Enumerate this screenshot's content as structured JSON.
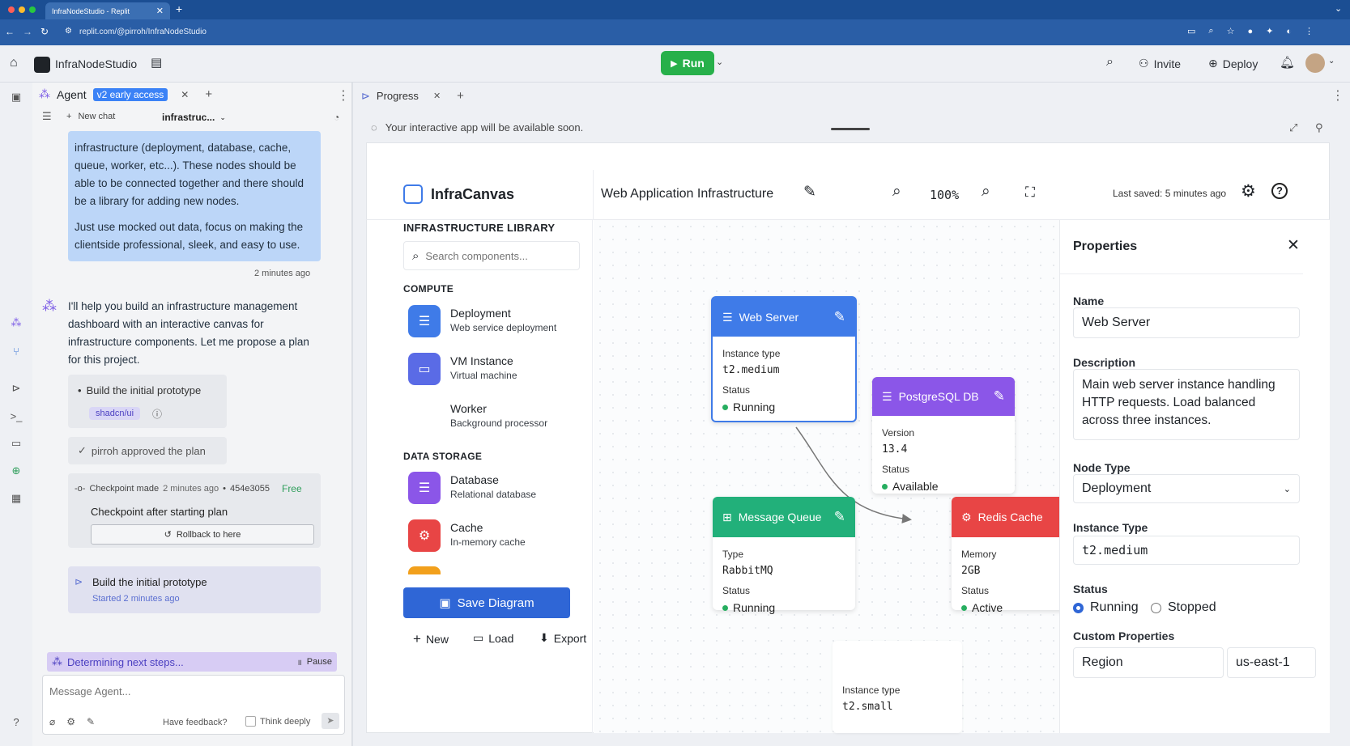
{
  "browser": {
    "tab_title": "InfraNodeStudio - Replit",
    "url": "replit.com/@pirroh/InfraNodeStudio"
  },
  "header": {
    "project_name": "InfraNodeStudio",
    "run_label": "Run",
    "invite_label": "Invite",
    "deploy_label": "Deploy"
  },
  "agent_panel": {
    "tab_label": "Agent",
    "badge": "v2 early access",
    "new_chat": "New chat",
    "chat_title": "infrastruc...",
    "user_message_p1": "infrastructure (deployment, database, cache, queue, worker, etc...). These nodes should be able to be connected together and there should be a library for adding new nodes.",
    "user_message_p2": "Just use mocked out data, focus on making the clientside professional, sleek, and easy to use.",
    "user_time": "2 minutes ago",
    "agent_message": "I'll help you build an infrastructure management dashboard with an interactive canvas for infrastructure components. Let me propose a plan for this project.",
    "plan_item": "Build the initial prototype",
    "plan_chip": "shadcn/ui",
    "approved": "pirroh approved the plan",
    "checkpoint_prefix": "Checkpoint made",
    "checkpoint_time": "2 minutes ago",
    "checkpoint_hash": "454e3055",
    "checkpoint_free": "Free",
    "checkpoint_title": "Checkpoint after starting plan",
    "rollback": "Rollback to here",
    "task_title": "Build the initial prototype",
    "task_started": "Started 2 minutes ago",
    "status_text": "Determining next steps...",
    "pause": "Pause",
    "input_placeholder": "Message Agent...",
    "feedback": "Have feedback?",
    "think_deeply": "Think deeply"
  },
  "progress_panel": {
    "tab_label": "Progress",
    "notice": "Your interactive app will be available soon."
  },
  "app": {
    "logo_text": "InfraCanvas",
    "diagram_title": "Web Application Infrastructure",
    "zoom": "100%",
    "last_saved": "Last saved: 5 minutes ago",
    "library_title": "INFRASTRUCTURE LIBRARY",
    "search_placeholder": "Search components...",
    "compute_label": "COMPUTE",
    "data_storage_label": "DATA STORAGE",
    "compute_items": [
      {
        "name": "Deployment",
        "sub": "Web service deployment",
        "color": "#3f7be8"
      },
      {
        "name": "VM Instance",
        "sub": "Virtual machine",
        "color": "#5a6be6"
      },
      {
        "name": "Worker",
        "sub": "Background processor",
        "color": ""
      }
    ],
    "storage_items": [
      {
        "name": "Database",
        "sub": "Relational database",
        "color": "#8b56e8"
      },
      {
        "name": "Cache",
        "sub": "In-memory cache",
        "color": "#e84545"
      }
    ],
    "save_button": "Save Diagram",
    "new_label": "New",
    "load_label": "Load",
    "export_label": "Export"
  },
  "nodes": {
    "web_server": {
      "title": "Web Server",
      "l1": "Instance type",
      "v1": "t2.medium",
      "l2": "Status",
      "status": "Running",
      "color": "#3f7be8"
    },
    "postgres": {
      "title": "PostgreSQL DB",
      "l1": "Version",
      "v1": "13.4",
      "l2": "Status",
      "status": "Available",
      "color": "#8b56e8"
    },
    "queue": {
      "title": "Message Queue",
      "l1": "Type",
      "v1": "RabbitMQ",
      "l2": "Status",
      "status": "Running",
      "color": "#22b07a"
    },
    "redis": {
      "title": "Redis Cache",
      "l1": "Memory",
      "v1": "2GB",
      "l2": "Status",
      "status": "Active",
      "color": "#e84545"
    },
    "ghost": {
      "l1": "Instance type",
      "v1": "t2.small"
    }
  },
  "properties": {
    "title": "Properties",
    "name_label": "Name",
    "name_value": "Web Server",
    "desc_label": "Description",
    "desc_value": "Main web server instance handling HTTP requests. Load balanced across three instances.",
    "type_label": "Node Type",
    "type_value": "Deployment",
    "inst_label": "Instance Type",
    "inst_value": "t2.medium",
    "status_label": "Status",
    "status_running": "Running",
    "status_stopped": "Stopped",
    "custom_label": "Custom Properties",
    "custom_key": "Region",
    "custom_value": "us-east-1"
  }
}
